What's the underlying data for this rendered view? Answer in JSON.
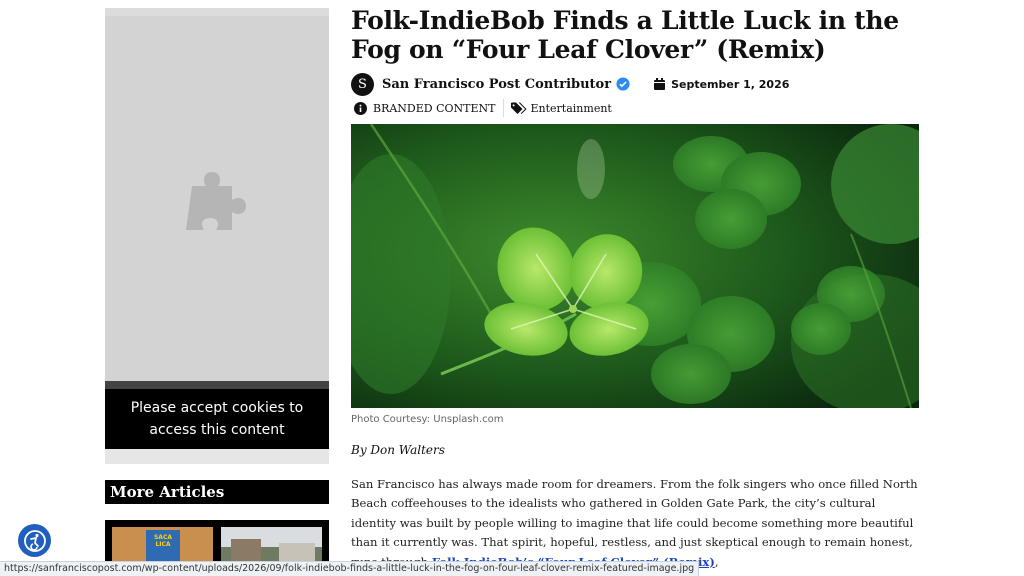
{
  "article": {
    "headline": "Folk-IndieBob Finds a Little Luck in the Fog on “Four Leaf Clover” (Remix)",
    "author_initial": "S",
    "author": "San Francisco Post Contributor",
    "date": "September 1, 2026",
    "branded_label": "BRANDED CONTENT",
    "category": "Entertainment",
    "photo_caption": "Photo Courtesy: Unsplash.com",
    "byline": "By Don Walters",
    "body_start": "San Francisco has always made room for dreamers. From the folk singers who once filled North Beach coffeehouses to the idealists who gathered in Golden Gate Park, the city’s cultural identity was built by people willing to imagine that life could become something more beautiful than it currently was. That spirit, hopeful, restless, and just skeptical enough to remain honest, runs through ",
    "body_link": "Folk-IndieBob’s “Four Leaf Clover” (Remix)",
    "body_end": ","
  },
  "sidebar": {
    "cookie_notice": "Please accept cookies to access this content",
    "more_articles": "More Articles",
    "thumb1_text": "SACA LICA"
  },
  "status_bar": {
    "url": "https://sanfranciscopost.com/wp-content/uploads/2026/09/folk-indiebob-finds-a-little-luck-in-the-fog-on-four-leaf-clover-remix-featured-image.jpg"
  },
  "icons": {
    "placeholder": "puzzle-piece-icon",
    "verified": "verified-badge-icon",
    "calendar": "calendar-icon",
    "info": "info-icon",
    "tags": "tags-icon",
    "accessibility": "accessibility-icon"
  },
  "colors": {
    "link": "#1a44c2",
    "verified": "#2d8cf0",
    "a11y_button": "#1f5fbf",
    "panel_black": "#000000"
  }
}
